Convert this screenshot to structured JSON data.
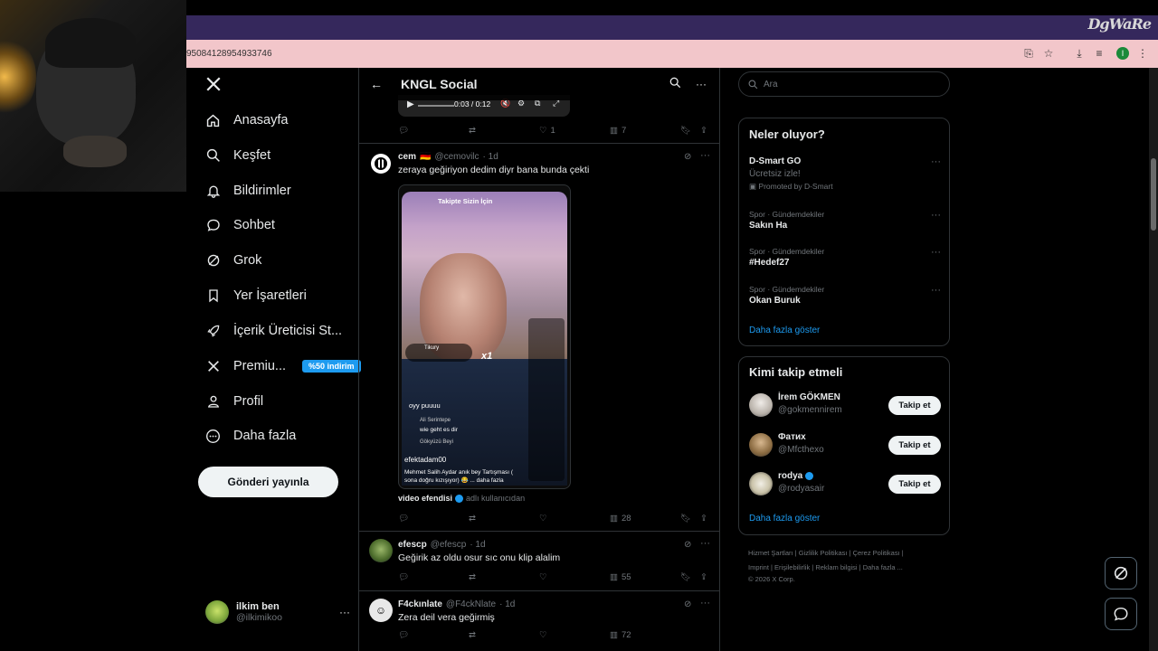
{
  "browser": {
    "url": "95084128954933746",
    "watermark": "DgWaRe"
  },
  "nav": {
    "items": [
      {
        "label": "Anasayfa",
        "icon": "home-icon"
      },
      {
        "label": "Keşfet",
        "icon": "search-icon"
      },
      {
        "label": "Bildirimler",
        "icon": "bell-icon"
      },
      {
        "label": "Sohbet",
        "icon": "chat-icon"
      },
      {
        "label": "Grok",
        "icon": "grok-icon"
      },
      {
        "label": "Yer İşaretleri",
        "icon": "bookmark-icon"
      },
      {
        "label": "İçerik Üreticisi St...",
        "icon": "rocket-icon"
      },
      {
        "label": "Premiu...",
        "icon": "x-icon",
        "badge": "%50 indirim"
      },
      {
        "label": "Profil",
        "icon": "person-icon"
      },
      {
        "label": "Daha fazla",
        "icon": "more-circle-icon"
      }
    ],
    "post_button": "Gönderi yayınla",
    "account": {
      "name": "ilkim ben",
      "handle": "@ilkimikoo"
    }
  },
  "center": {
    "header_title": "KNGL Social",
    "video1": {
      "time": "0:03 / 0:12"
    },
    "row1_actions": {
      "likes": "1",
      "views": "7"
    },
    "tweet1": {
      "name": "cem",
      "flag": "🇩🇪",
      "handle": "@cemovilc",
      "time": "· 1d",
      "text": "zeraya geğiriyon dedim diyr bana bunda  çekti",
      "video_label_from": "video efendisi",
      "video_label_suffix": "adlı kullanıcıdan",
      "views": "28",
      "video_overlay": {
        "tabs": "Takipte   Sizin İçin",
        "user": "Tikury",
        "multiplier": "x1",
        "comment1": "oyy puuuu",
        "comment2_user": "Ali Serintepe",
        "comment2": "wie geht es dir",
        "comment3_user": "Gökyüzü Beyi",
        "comment4_user": "efektadam00",
        "comment4": "Mehmet Salih Aydar anık bey  Tartışması ( sona doğru kızışıyor) 😂 ... daha fazla"
      }
    },
    "tweet2": {
      "name": "efescp",
      "handle": "@efescp",
      "time": "· 1d",
      "text": "Geğirik az oldu osur sıc onu klip alalim",
      "views": "55"
    },
    "tweet3": {
      "name": "F4ckınlate",
      "handle": "@F4ckNlate",
      "time": "· 1d",
      "text": "Zera deil vera geğirmiş",
      "views": "72"
    }
  },
  "right": {
    "search_placeholder": "Ara",
    "trends_title": "Neler oluyor?",
    "trends": [
      {
        "category": "",
        "title": "D-Smart GO",
        "sub": "Ücretsiz izle!",
        "promo": "Promoted by D-Smart"
      },
      {
        "category": "Spor · Gündemdekiler",
        "title": "Sakın Ha"
      },
      {
        "category": "Spor · Gündemdekiler",
        "title": "#Hedef27"
      },
      {
        "category": "Spor · Gündemdekiler",
        "title": "Okan Buruk"
      }
    ],
    "show_more": "Daha fazla göster",
    "follow_title": "Kimi takip etmeli",
    "follow": [
      {
        "name": "İrem GÖKMEN",
        "handle": "@gokmennirem",
        "button": "Takip et"
      },
      {
        "name": "Фатих",
        "handle": "@Mfcthexo",
        "button": "Takip et"
      },
      {
        "name": "rodya",
        "handle": "@rodyasair",
        "button": "Takip et",
        "verified": true
      }
    ],
    "footer": {
      "line1": "Hizmet Şartları  |  Gizlilik Politikası  |  Çerez Politikası  |",
      "line2": "Imprint  |  Erişilebilirlik  |  Reklam bilgisi  |  Daha fazla ...",
      "line3": "© 2026 X Corp."
    }
  },
  "colors": {
    "accent": "#1d9bf0",
    "border": "#2f3336",
    "muted": "#71767b",
    "browser_top": "#35285c",
    "urlbar": "#f2c6ca"
  }
}
